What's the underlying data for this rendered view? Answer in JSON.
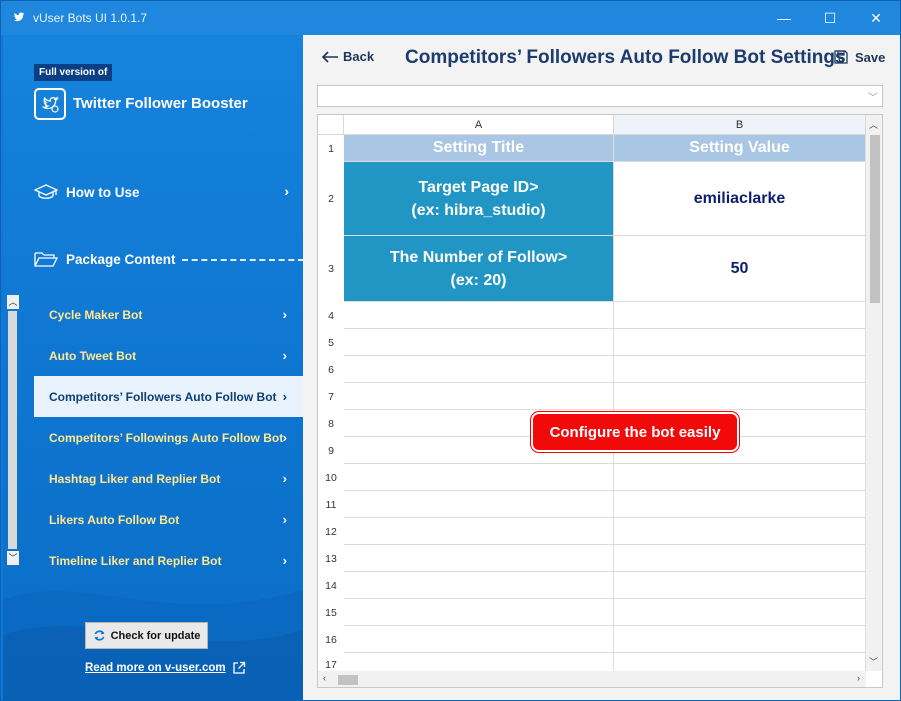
{
  "window": {
    "title": "vUser Bots UI 1.0.1.7",
    "minimize_glyph": "—",
    "maximize_glyph": "☐",
    "close_glyph": "✕"
  },
  "sidebar": {
    "badge": "Full version of",
    "brand_name": "Twitter Follower Booster",
    "brand_icon": "twitter-bird-icon",
    "how_to_use": "How to Use",
    "package_content": "Package Content",
    "chevron": "›",
    "items": [
      {
        "label": "Cycle Maker Bot",
        "active": false
      },
      {
        "label": "Auto Tweet Bot",
        "active": false
      },
      {
        "label": "Competitors’ Followers Auto Follow Bot",
        "active": true
      },
      {
        "label": "Competitors’ Followings Auto Follow Bot",
        "active": false
      },
      {
        "label": "Hashtag Liker and Replier Bot",
        "active": false
      },
      {
        "label": "Likers Auto Follow Bot",
        "active": false
      },
      {
        "label": "Timeline Liker and Replier Bot",
        "active": false
      }
    ],
    "update_button": "Check for update",
    "read_more": "Read more on v-user.com"
  },
  "main": {
    "back_label": "Back",
    "page_title": "Competitors’ Followers Auto Follow Bot Settings",
    "save_label": "Save",
    "callout": "Configure the bot easily"
  },
  "sheet": {
    "columns": [
      "A",
      "B"
    ],
    "header_row": {
      "a": "Setting Title",
      "b": "Setting Value"
    },
    "rows": [
      {
        "title": "Target Page ID>\n(ex: hibra_studio)",
        "value": "emiliaclarke"
      },
      {
        "title": "The Number of Follow>\n(ex: 20)",
        "value": "50"
      }
    ],
    "row_numbers": [
      "1",
      "2",
      "3",
      "4",
      "5",
      "6",
      "7",
      "8",
      "9",
      "10",
      "11",
      "12",
      "13",
      "14",
      "15",
      "16",
      "17"
    ]
  },
  "colors": {
    "header_cell": "#a9c6e4",
    "label_cell": "#2196c5",
    "value_text": "#0c1f6a",
    "callout": "#f20a0a",
    "nav_text": "#ffe890"
  }
}
